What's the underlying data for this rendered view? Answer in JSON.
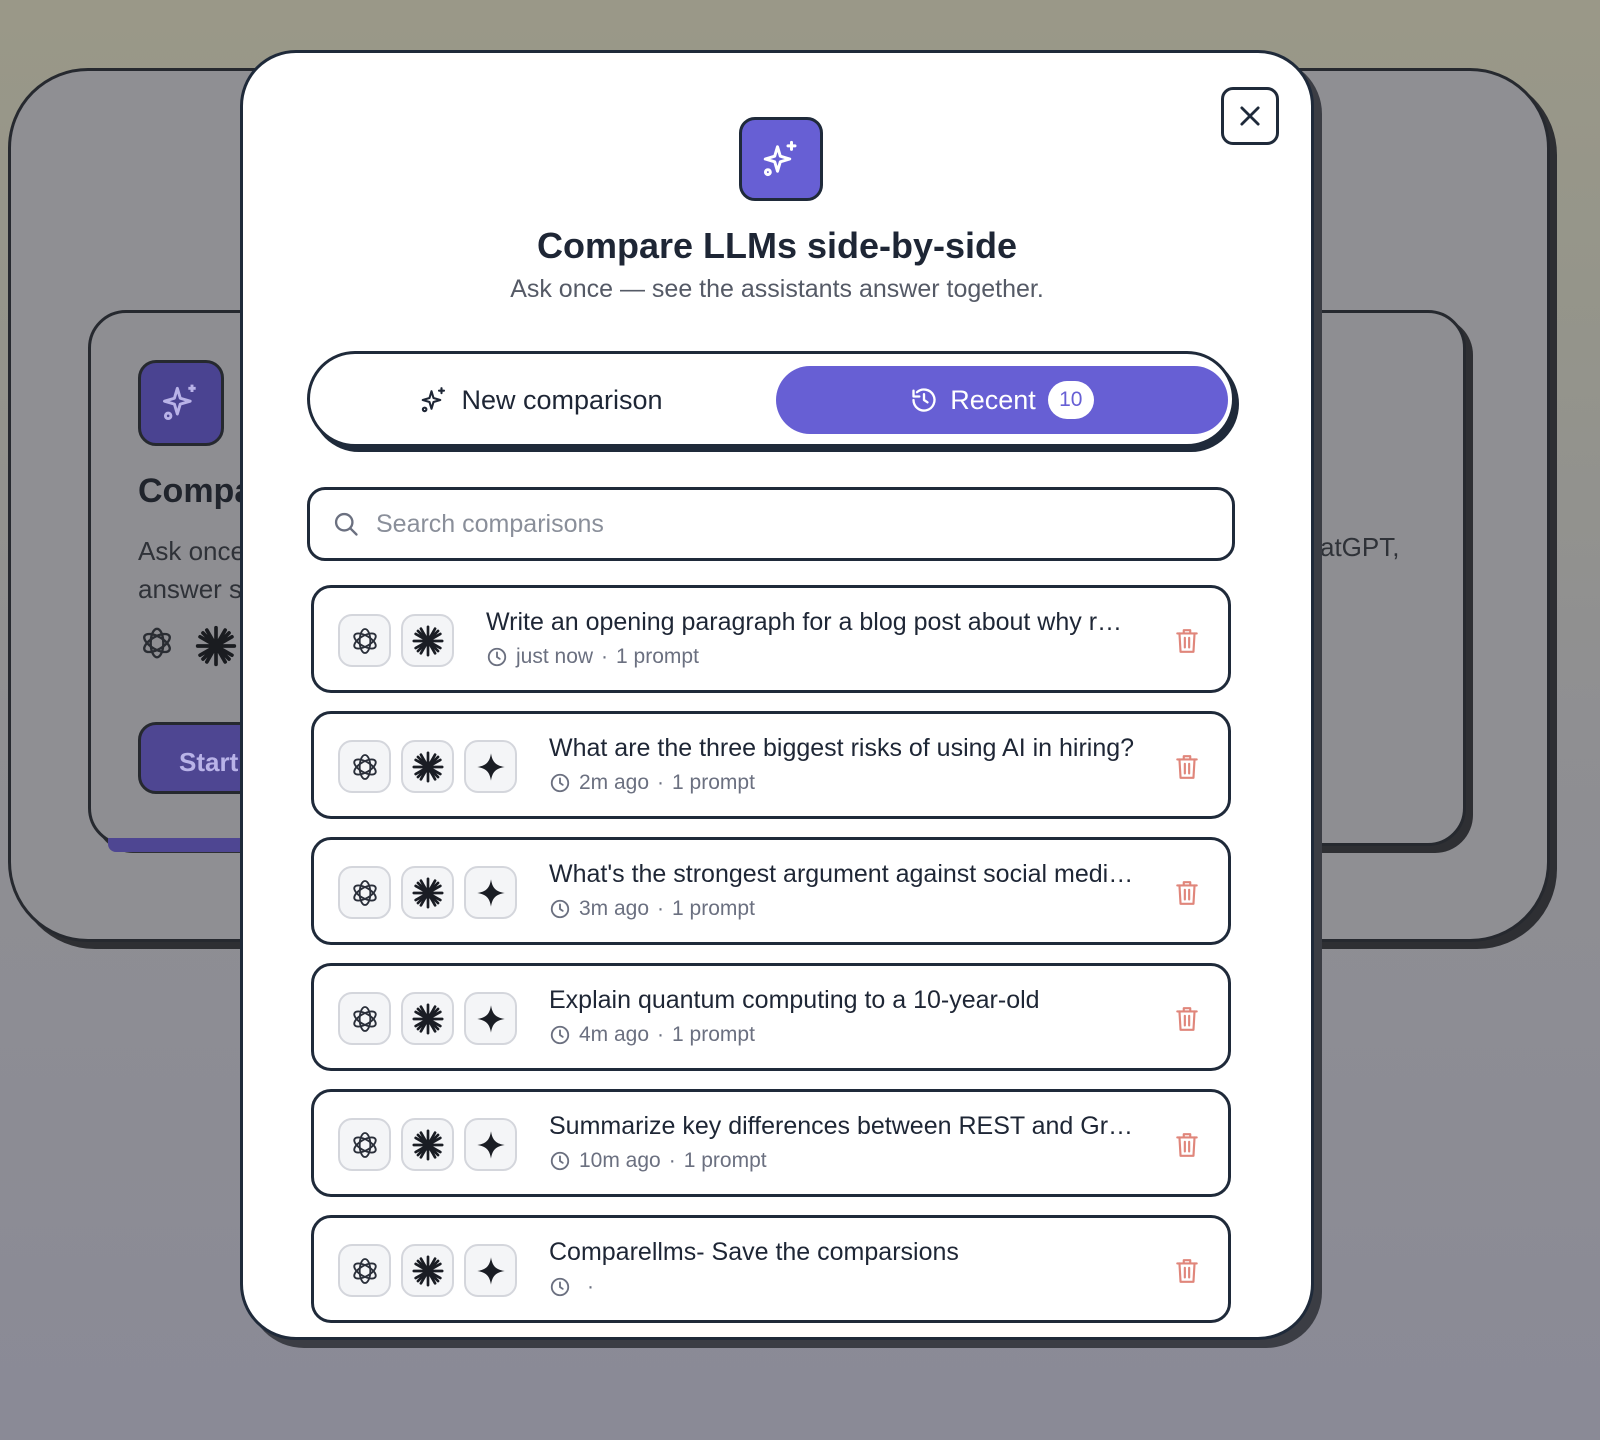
{
  "background": {
    "title_partial": "Compa",
    "desc_line1": "Ask once",
    "desc_line2": "answer s",
    "desc_right": "atGPT,",
    "start_label": "Start"
  },
  "modal": {
    "title": "Compare LLMs side-by-side",
    "subtitle": "Ask once — see the assistants answer together.",
    "tabs": {
      "new_label": "New comparison",
      "recent_label": "Recent",
      "recent_count": "10"
    },
    "search": {
      "placeholder": "Search comparisons",
      "value": ""
    },
    "items": [
      {
        "prompt": "Write an opening paragraph for a blog post about why r…",
        "time": "just now",
        "count": "1 prompt",
        "models": [
          "chatgpt",
          "claude"
        ]
      },
      {
        "prompt": "What are the three biggest risks of using AI in hiring?",
        "time": "2m ago",
        "count": "1 prompt",
        "models": [
          "chatgpt",
          "claude",
          "gemini"
        ]
      },
      {
        "prompt": "What's the strongest argument against social medi…",
        "time": "3m ago",
        "count": "1 prompt",
        "models": [
          "chatgpt",
          "claude",
          "gemini"
        ]
      },
      {
        "prompt": "Explain quantum computing to a 10-year-old",
        "time": "4m ago",
        "count": "1 prompt",
        "models": [
          "chatgpt",
          "claude",
          "gemini"
        ]
      },
      {
        "prompt": "Summarize key differences between REST and Gr…",
        "time": "10m ago",
        "count": "1 prompt",
        "models": [
          "chatgpt",
          "claude",
          "gemini"
        ]
      },
      {
        "prompt": "Comparellms- Save the comparsions",
        "time": "",
        "count": "",
        "models": [
          "chatgpt",
          "claude",
          "gemini"
        ]
      }
    ]
  },
  "colors": {
    "accent": "#675fd4",
    "border": "#1f2a3a",
    "trash": "#e0867b"
  },
  "icons": {
    "logo": "sparkles-icon",
    "close": "close-icon",
    "search": "search-icon",
    "recent": "history-icon",
    "clock": "clock-icon",
    "trash": "trash-icon",
    "models": [
      "chatgpt-icon",
      "claude-icon",
      "gemini-icon"
    ]
  }
}
